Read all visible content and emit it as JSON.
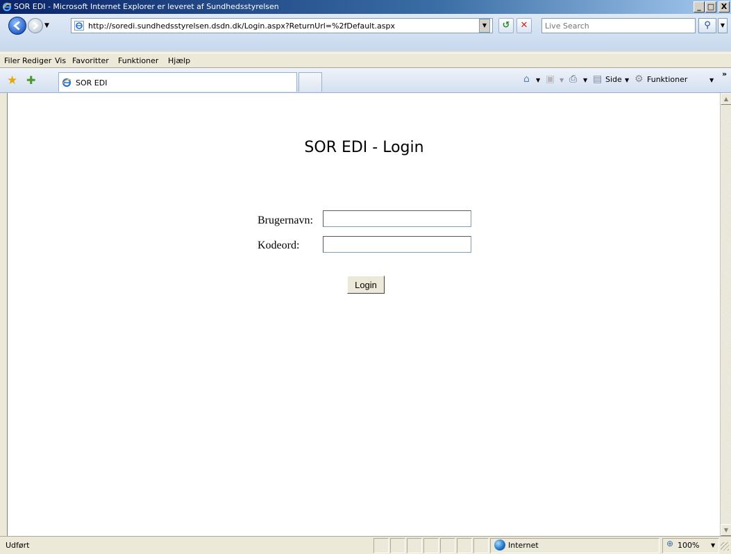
{
  "window": {
    "title": "SOR EDI - Microsoft Internet Explorer er leveret af Sundhedsstyrelsen",
    "minimize": "_",
    "maximize": "□",
    "close": "X"
  },
  "address": {
    "url": "http://soredi.sundhedsstyrelsen.dsdn.dk/Login.aspx?ReturnUrl=%2fDefault.aspx",
    "search_placeholder": "Live Search"
  },
  "menu": [
    "Filer",
    "Rediger",
    "Vis",
    "Favoritter",
    "Funktioner",
    "Hjælp"
  ],
  "tab": {
    "label": "SOR EDI"
  },
  "commands": {
    "page": "Side",
    "tools": "Funktioner",
    "more": "»"
  },
  "page": {
    "title": "SOR EDI - Login",
    "username_label": "Brugernavn:",
    "password_label": "Kodeord:",
    "username_value": "",
    "password_value": "",
    "login_button": "Login"
  },
  "status": {
    "text": "Udført",
    "zone": "Internet",
    "zoom": "100%"
  }
}
